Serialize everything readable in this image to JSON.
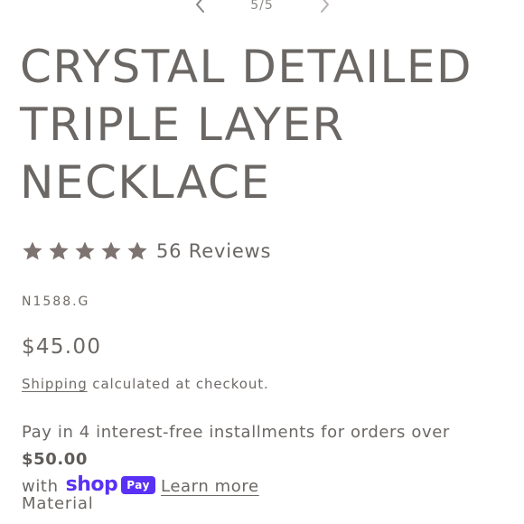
{
  "gallery": {
    "counter": "5/5",
    "prev_icon": "chevron-left-icon",
    "next_icon": "chevron-right-icon"
  },
  "product": {
    "title": "CRYSTAL DETAILED TRIPLE LAYER NECKLACE",
    "rating": {
      "stars_filled": 5,
      "stars_total": 5,
      "star_icon": "star-icon",
      "star_color": "#7d7370",
      "reviews_text": "56 Reviews"
    },
    "sku": "N1588.G",
    "price": "$45.00",
    "shipping": {
      "link_text": "Shipping",
      "rest_text": " calculated at checkout."
    },
    "installments": {
      "text_before": "Pay in 4 interest-free installments for orders over ",
      "amount": "$50.00",
      "text_with": "with",
      "brand_shop": "shop",
      "brand_pay": "Pay",
      "brand_color": "#5a31f4",
      "learn_more": "Learn more"
    },
    "material_label": "Material"
  }
}
